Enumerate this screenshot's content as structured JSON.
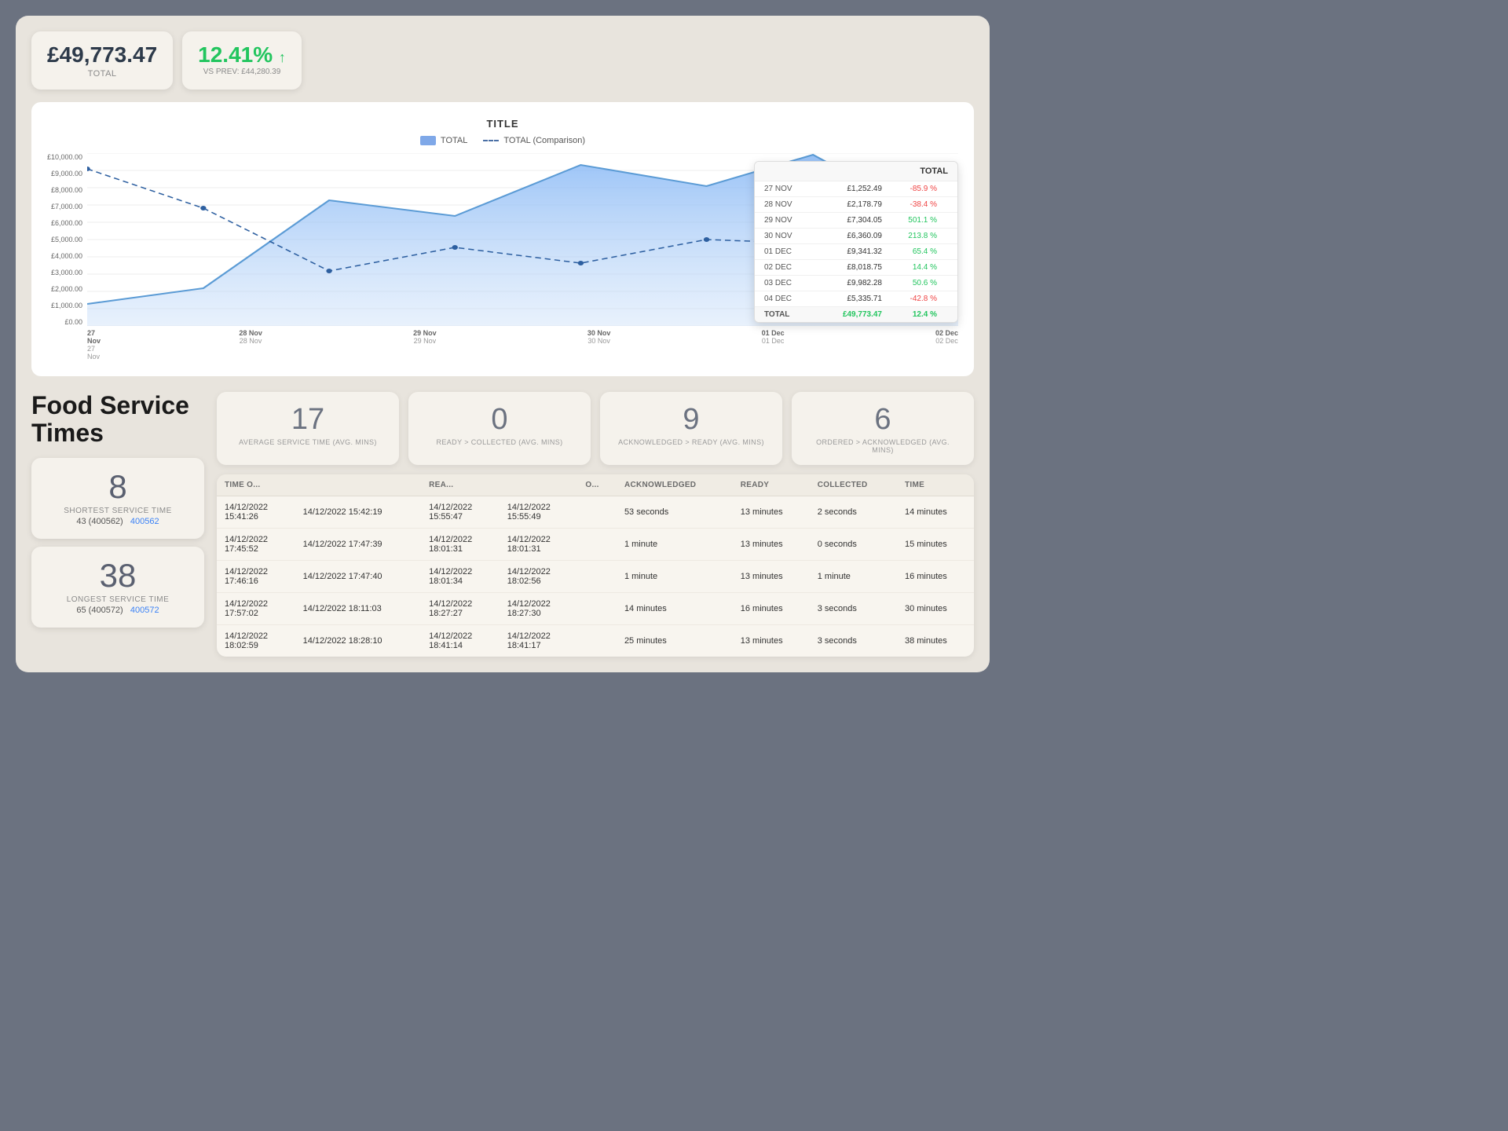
{
  "top": {
    "total_value": "£49,773.47",
    "total_label": "TOTAL",
    "pct_value": "12.41%",
    "pct_arrow": "↑",
    "vs_prev_label": "VS PREV: £44,280.39"
  },
  "chart": {
    "title": "TITLE",
    "legend": {
      "total": "TOTAL",
      "comparison": "TOTAL (Comparison)"
    },
    "y_axis": [
      "£10,000.00",
      "£9,000.00",
      "£8,000.00",
      "£7,000.00",
      "£6,000.00",
      "£5,000.00",
      "£4,000.00",
      "£3,000.00",
      "£2,000.00",
      "£1,000.00",
      "£0.00"
    ],
    "x_axis": [
      "27 Nov",
      "28 Nov",
      "29 Nov",
      "30 Nov",
      "01 Dec",
      "02 Dec"
    ]
  },
  "tooltip": {
    "header": "TOTAL",
    "rows": [
      {
        "date": "27 NOV",
        "amount": "£1,252.49",
        "change": "-85.9 %",
        "neg": true
      },
      {
        "date": "28 NOV",
        "amount": "£2,178.79",
        "change": "-38.4 %",
        "neg": true
      },
      {
        "date": "29 NOV",
        "amount": "£7,304.05",
        "change": "501.1 %",
        "neg": false
      },
      {
        "date": "30 NOV",
        "amount": "£6,360.09",
        "change": "213.8 %",
        "neg": false
      },
      {
        "date": "01 DEC",
        "amount": "£9,341.32",
        "change": "65.4 %",
        "neg": false
      },
      {
        "date": "02 DEC",
        "amount": "£8,018.75",
        "change": "14.4 %",
        "neg": false
      },
      {
        "date": "03 DEC",
        "amount": "£9,982.28",
        "change": "50.6 %",
        "neg": false
      },
      {
        "date": "04 DEC",
        "amount": "£5,335.71",
        "change": "-42.8 %",
        "neg": true
      },
      {
        "date": "TOTAL",
        "amount": "£49,773.47",
        "change": "12.4 %",
        "neg": false
      }
    ]
  },
  "food_service": {
    "title": "Food Service Times",
    "metrics": [
      {
        "number": "17",
        "label": "AVERAGE SERVICE TIME (AVG. MINS)"
      },
      {
        "number": "0",
        "label": "READY > COLLECTED (AVG. MINS)"
      },
      {
        "number": "9",
        "label": "ACKNOWLEDGED > READY (AVG. MINS)"
      },
      {
        "number": "6",
        "label": "ORDERED > ACKNOWLEDGED (AVG. MINS)"
      }
    ],
    "shortest": {
      "number": "8",
      "label": "SHORTEST SERVICE TIME"
    },
    "longest": {
      "number": "38",
      "label": "LONGEST SERVICE TIME"
    },
    "order_ref_shortest": "43 (400562)",
    "order_ref_shortest_link": "400562",
    "order_ref_longest": "65 (400572)",
    "order_ref_longest_link": "400572"
  },
  "table": {
    "headers": [
      "TIME O...",
      "",
      "REA...",
      "",
      "O...",
      "ACKNOWLEDGED",
      "READY",
      "COLLECTED",
      "TIME"
    ],
    "rows": [
      {
        "col1": "14/12/2022 15:41:26",
        "col2": "14/12/2022 15:42:19",
        "col3": "14/12/2022 15:55:47",
        "col4": "14/12/2022 15:55:49",
        "ack": "53 seconds",
        "ready": "13 minutes",
        "collected": "2 seconds",
        "time": "14 minutes"
      },
      {
        "col1": "14/12/2022 17:45:52",
        "col2": "14/12/2022 17:47:39",
        "col3": "14/12/2022 18:01:31",
        "col4": "14/12/2022 18:01:31",
        "ack": "1 minute",
        "ready": "13 minutes",
        "collected": "0 seconds",
        "time": "15 minutes"
      },
      {
        "col1": "14/12/2022 17:46:16",
        "col2": "14/12/2022 17:47:40",
        "col3": "14/12/2022 18:01:34",
        "col4": "14/12/2022 18:02:56",
        "ack": "1 minute",
        "ready": "13 minutes",
        "collected": "1 minute",
        "time": "16 minutes"
      },
      {
        "col1": "14/12/2022 17:57:02",
        "col2": "14/12/2022 18:11:03",
        "col3": "14/12/2022 18:27:27",
        "col4": "14/12/2022 18:27:30",
        "ack": "14 minutes",
        "ready": "16 minutes",
        "collected": "3 seconds",
        "time": "30 minutes"
      },
      {
        "col1": "14/12/2022 18:02:59",
        "col2": "14/12/2022 18:28:10",
        "col3": "14/12/2022 18:41:14",
        "col4": "14/12/2022 18:41:17",
        "ack": "25 minutes",
        "ready": "13 minutes",
        "collected": "3 seconds",
        "time": "38 minutes"
      }
    ]
  }
}
